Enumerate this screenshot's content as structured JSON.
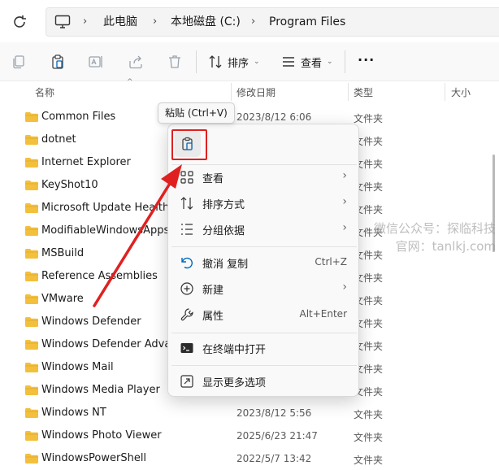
{
  "breadcrumb": [
    "此电脑",
    "本地磁盘 (C:)",
    "Program Files"
  ],
  "toolbar": {
    "sort_label": "排序",
    "view_label": "查看",
    "more_label": "···"
  },
  "columns": {
    "name": "名称",
    "modified": "修改日期",
    "type": "类型",
    "size": "大小"
  },
  "files": [
    {
      "name": "Common Files",
      "date": "2023/8/12 6:06",
      "type": "文件夹"
    },
    {
      "name": "dotnet",
      "date": "",
      "type": "文件夹"
    },
    {
      "name": "Internet Explorer",
      "date": "",
      "type": "文件夹"
    },
    {
      "name": "KeyShot10",
      "date": "",
      "type": "文件夹"
    },
    {
      "name": "Microsoft Update Health T",
      "date": "",
      "type": "文件夹"
    },
    {
      "name": "ModifiableWindowsApps",
      "date": "",
      "type": "文件夹"
    },
    {
      "name": "MSBuild",
      "date": "",
      "type": "文件夹"
    },
    {
      "name": "Reference Assemblies",
      "date": "",
      "type": "文件夹"
    },
    {
      "name": "VMware",
      "date": "",
      "type": "文件夹"
    },
    {
      "name": "Windows Defender",
      "date": "",
      "type": "文件夹"
    },
    {
      "name": "Windows Defender Advance",
      "date": "",
      "type": "文件夹"
    },
    {
      "name": "Windows Mail",
      "date": "",
      "type": "文件夹"
    },
    {
      "name": "Windows Media Player",
      "date": "",
      "type": "文件夹"
    },
    {
      "name": "Windows NT",
      "date": "2023/8/12 5:56",
      "type": "文件夹"
    },
    {
      "name": "Windows Photo Viewer",
      "date": "2025/6/23 21:47",
      "type": "文件夹"
    },
    {
      "name": "WindowsPowerShell",
      "date": "2022/5/7 13:42",
      "type": "文件夹"
    }
  ],
  "tooltip": "粘贴 (Ctrl+V)",
  "context_menu": {
    "view": "查看",
    "sort": "排序方式",
    "group": "分组依据",
    "undo": "撤消 复制",
    "undo_shortcut": "Ctrl+Z",
    "new": "新建",
    "properties": "属性",
    "properties_shortcut": "Alt+Enter",
    "terminal": "在终端中打开",
    "more_options": "显示更多选项"
  },
  "watermark": {
    "line1": "微信公众号：探临科技",
    "line2": "官网：tanlkj.com"
  },
  "colors": {
    "folder": "#f3c03d",
    "accent": "#0067c0",
    "annotation": "#e02020"
  }
}
